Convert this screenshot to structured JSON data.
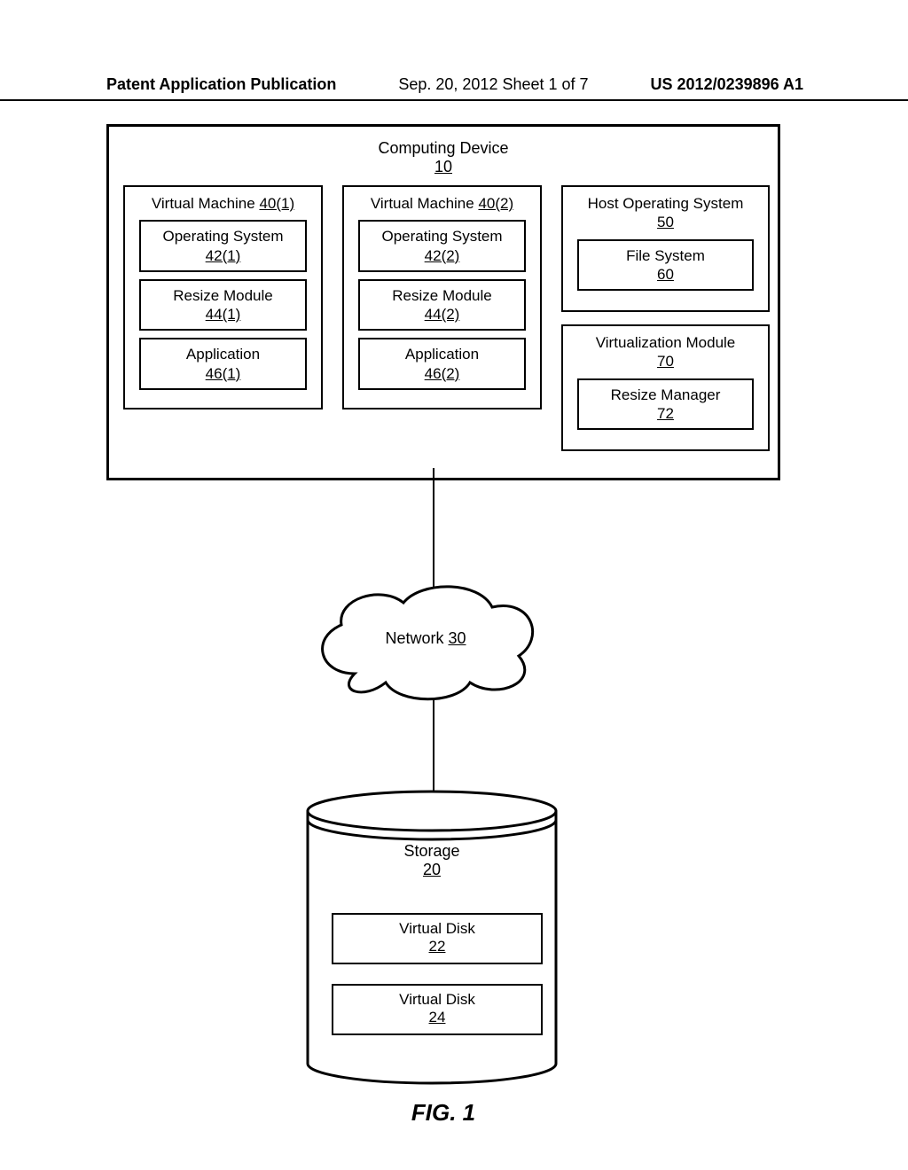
{
  "header": {
    "left": "Patent Application Publication",
    "center": "Sep. 20, 2012  Sheet 1 of 7",
    "right": "US 2012/0239896 A1"
  },
  "device": {
    "title": "Computing Device",
    "ref": "10"
  },
  "vm1": {
    "title_prefix": "Virtual Machine ",
    "ref": "40(1)",
    "os_label": "Operating System",
    "os_ref": "42(1)",
    "resize_label": "Resize Module",
    "resize_ref": "44(1)",
    "app_label": "Application",
    "app_ref": "46(1)"
  },
  "vm2": {
    "title_prefix": "Virtual Machine ",
    "ref": "40(2)",
    "os_label": "Operating System",
    "os_ref": "42(2)",
    "resize_label": "Resize Module",
    "resize_ref": "44(2)",
    "app_label": "Application",
    "app_ref": "46(2)"
  },
  "host": {
    "title": "Host Operating System",
    "ref": "50",
    "fs_label": "File System",
    "fs_ref": "60"
  },
  "virt": {
    "title": "Virtualization Module",
    "ref": "70",
    "rm_label": "Resize Manager",
    "rm_ref": "72"
  },
  "network": {
    "label": "Network ",
    "ref": "30"
  },
  "storage": {
    "label": "Storage",
    "ref": "20",
    "vd1_label": "Virtual Disk",
    "vd1_ref": "22",
    "vd2_label": "Virtual Disk",
    "vd2_ref": "24"
  },
  "figure": {
    "label": "FIG. 1"
  }
}
